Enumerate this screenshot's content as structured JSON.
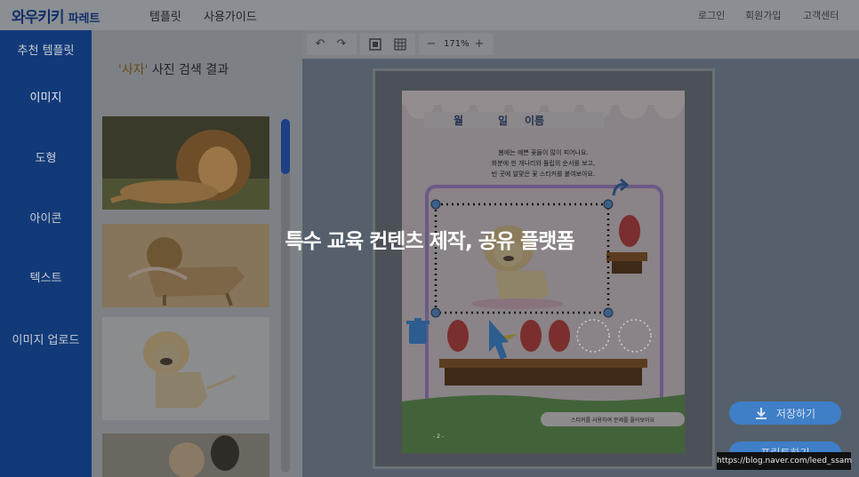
{
  "header": {
    "logo": "와우키키",
    "logo_sub": "파레트",
    "nav": [
      "템플릿",
      "사용가이드"
    ],
    "right_links": [
      "로그인",
      "회원가입",
      "고객센터"
    ]
  },
  "sidebar": {
    "items": [
      {
        "label": "추천 템플릿"
      },
      {
        "label": "이미지"
      },
      {
        "label": "도형"
      },
      {
        "label": "아이콘"
      },
      {
        "label": "텍스트"
      },
      {
        "label": "이미지 업로드"
      }
    ]
  },
  "panel": {
    "keyword": "'사자'",
    "title_rest": " 사진 검색 결과"
  },
  "toolbar": {
    "zoom_minus": "−",
    "zoom_value": "171%",
    "zoom_plus": "+"
  },
  "worksheet": {
    "month": "월",
    "day": "일",
    "name": "이름",
    "instructions": [
      "봄에는 예쁜 꽃들이 많이 피어나요.",
      "화분에 핀 개나리와 튤립의 순서를 보고,",
      "빈 곳에 알맞은 꽃 스티커를 붙여보아요."
    ],
    "bottom_note": "스티커를 사용하여 문제를 풀어보아요",
    "page_number": "- 2 -"
  },
  "overlay_title": "특수 교육 컨텐츠 제작, 공유 플랫폼",
  "actions": {
    "save": "저장하기",
    "print": "프린트하기"
  },
  "watermark": "https://blog.naver.com/leed_ssam"
}
